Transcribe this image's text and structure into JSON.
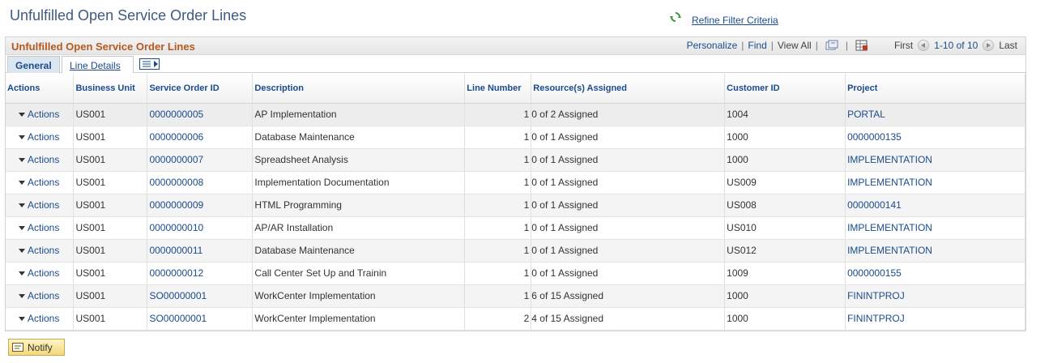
{
  "page": {
    "title": "Unfulfilled Open Service Order Lines",
    "refine_label": "Refine Filter Criteria"
  },
  "grid": {
    "title": "Unfulfilled Open Service Order Lines",
    "personalize": "Personalize",
    "find": "Find",
    "view_all": "View All",
    "first": "First",
    "range": "1-10 of 10",
    "last": "Last",
    "sep": "|"
  },
  "tabs": {
    "general": "General",
    "line_details": "Line Details"
  },
  "columns": {
    "actions": "Actions",
    "business_unit": "Business Unit",
    "service_order_id": "Service Order ID",
    "description": "Description",
    "line_number": "Line Number",
    "resources": "Resource(s) Assigned",
    "customer_id": "Customer ID",
    "project": "Project"
  },
  "rows": [
    {
      "actions": "Actions",
      "bu": "US001",
      "so": "0000000005",
      "desc": "AP Implementation",
      "line": "1",
      "res": "0 of 2 Assigned",
      "cust": "1004",
      "proj": "PORTAL"
    },
    {
      "actions": "Actions",
      "bu": "US001",
      "so": "0000000006",
      "desc": "Database Maintenance",
      "line": "1",
      "res": "0 of 1 Assigned",
      "cust": "1000",
      "proj": "0000000135"
    },
    {
      "actions": "Actions",
      "bu": "US001",
      "so": "0000000007",
      "desc": "Spreadsheet Analysis",
      "line": "1",
      "res": "0 of 1 Assigned",
      "cust": "1000",
      "proj": "IMPLEMENTATION"
    },
    {
      "actions": "Actions",
      "bu": "US001",
      "so": "0000000008",
      "desc": "Implementation Documentation",
      "line": "1",
      "res": "0 of 1 Assigned",
      "cust": "US009",
      "proj": "IMPLEMENTATION"
    },
    {
      "actions": "Actions",
      "bu": "US001",
      "so": "0000000009",
      "desc": "HTML Programming",
      "line": "1",
      "res": "0 of 1 Assigned",
      "cust": "US008",
      "proj": "0000000141"
    },
    {
      "actions": "Actions",
      "bu": "US001",
      "so": "0000000010",
      "desc": "AP/AR Installation",
      "line": "1",
      "res": "0 of 1 Assigned",
      "cust": "US010",
      "proj": "IMPLEMENTATION"
    },
    {
      "actions": "Actions",
      "bu": "US001",
      "so": "0000000011",
      "desc": "Database Maintenance",
      "line": "1",
      "res": "0 of 1 Assigned",
      "cust": "US012",
      "proj": "IMPLEMENTATION"
    },
    {
      "actions": "Actions",
      "bu": "US001",
      "so": "0000000012",
      "desc": "Call Center Set Up and Trainin",
      "line": "1",
      "res": "0 of 1 Assigned",
      "cust": "1009",
      "proj": "0000000155"
    },
    {
      "actions": "Actions",
      "bu": "US001",
      "so": "SO00000001",
      "desc": "WorkCenter Implementation",
      "line": "1",
      "res": "6 of 15 Assigned",
      "cust": "1000",
      "proj": "FININTPROJ"
    },
    {
      "actions": "Actions",
      "bu": "US001",
      "so": "SO00000001",
      "desc": "WorkCenter Implementation",
      "line": "2",
      "res": "4 of 15 Assigned",
      "cust": "1000",
      "proj": "FININTPROJ"
    }
  ],
  "footer": {
    "notify_label": "Notify"
  },
  "icons": {
    "refine": "refresh-icon",
    "zoom": "zoom-grid-icon",
    "download": "download-excel-icon",
    "show_all_columns": "show-all-columns-icon",
    "notify": "notify-icon"
  },
  "colors": {
    "title": "#3d5a80",
    "grid_title": "#b35a1f",
    "link": "#1a4b8c"
  }
}
